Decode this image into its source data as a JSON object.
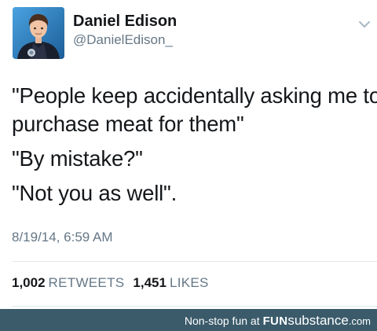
{
  "user": {
    "display_name": "Daniel Edison",
    "handle": "@DanielEdison_"
  },
  "menu_icon": "chevron-down-icon",
  "tweet": {
    "lines": [
      "\"People keep accidentally asking me to",
      "purchase meat for them\"",
      "\"By mistake?\"",
      "\"Not you as well\"."
    ]
  },
  "timestamp": "8/19/14, 6:59 AM",
  "stats": {
    "retweets_count": "1,002",
    "retweets_label": "RETWEETS",
    "likes_count": "1,451",
    "likes_label": "LIKES"
  },
  "footer": {
    "tagline": "Non-stop fun at",
    "brand_bold": "FUN",
    "brand_sub": "substance",
    "brand_domain": ".com"
  },
  "colors": {
    "text_primary": "#14171a",
    "text_secondary": "#657786",
    "divider": "#e1e8ed",
    "footer_bg": "#3b5b6b"
  }
}
